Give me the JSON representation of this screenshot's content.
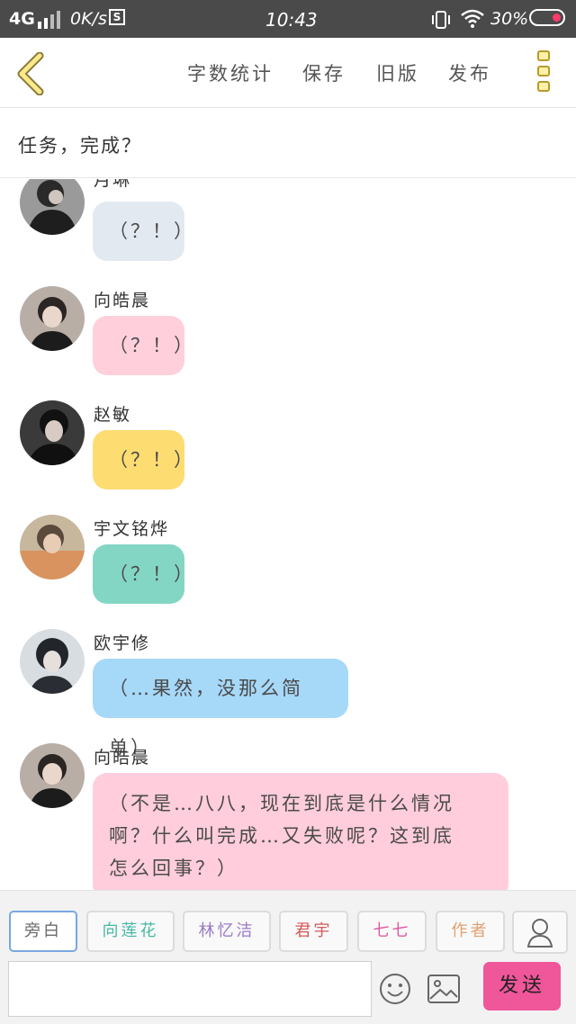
{
  "status_bar": {
    "network": "4G",
    "speed": "0K/s",
    "s_badge": "S",
    "time": "10:43",
    "battery": "30%"
  },
  "header": {
    "back_icon": "chevron-left-icon",
    "actions": [
      "字数统计",
      "保存",
      "旧版",
      "发布"
    ],
    "more_icon": "three-squares-menu-icon"
  },
  "task": {
    "title": "任务，完成？"
  },
  "messages": [
    {
      "sender": "月琳",
      "text": "（？！）",
      "color": "#e3e9f0",
      "avatar_icon": "avatar-photo"
    },
    {
      "sender": "向皓晨",
      "text": "（？！）",
      "color": "#ffcfdc",
      "avatar_icon": "avatar-photo"
    },
    {
      "sender": "赵敏",
      "text": "（？！）",
      "color": "#fddc72",
      "avatar_icon": "avatar-photo"
    },
    {
      "sender": "宇文铭烨",
      "text": "（？！）",
      "color": "#84d6c4",
      "avatar_icon": "avatar-photo"
    },
    {
      "sender": "欧宇修",
      "text": "（…果然，没那么简单）",
      "color": "#a6d8f8",
      "avatar_icon": "avatar-photo"
    },
    {
      "sender": "向皓晨",
      "lines": [
        "（不是…八八，现在到底是什么情况",
        "啊？什么叫完成…又失败呢？这到底",
        "怎么回事？）"
      ],
      "color": "#ffcddb",
      "avatar_icon": "avatar-photo"
    }
  ],
  "roles": [
    {
      "label": "旁白",
      "color": "#6a6a6a"
    },
    {
      "label": "向莲花",
      "color": "#46b8a4"
    },
    {
      "label": "林忆洁",
      "color": "#9a7ac8"
    },
    {
      "label": "君宇",
      "color": "#d45a5a"
    },
    {
      "label": "七七",
      "color": "#e05aa0"
    },
    {
      "label": "作者",
      "color": "#e0a070"
    }
  ],
  "input": {
    "placeholder": ""
  },
  "send_label": "发送",
  "colors": {
    "accent": "#f0569a",
    "header_icon": "#c8a628"
  }
}
